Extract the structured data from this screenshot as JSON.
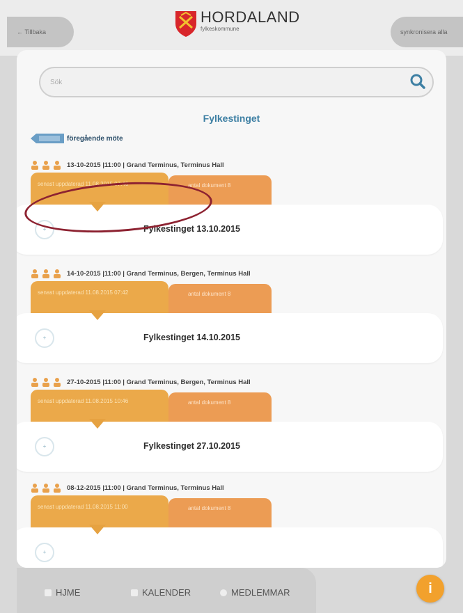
{
  "header": {
    "back_label": "← Tillbaka",
    "sync_label": "synkronisera alla",
    "logo_title": "HORDALAND",
    "logo_sub": "fylkeskommune"
  },
  "search": {
    "placeholder": "Sök"
  },
  "title": "Fylkestinget",
  "previous_label": "föregående möte",
  "meetings": [
    {
      "meta": "13-10-2015  |11:00  | Grand Terminus, Terminus Hall",
      "updated": "senast uppdaterad 11.08.2015 07:46",
      "docs": "antal dokument 8",
      "title": "Fylkestinget 13.10.2015"
    },
    {
      "meta": "14-10-2015  |11:00  | Grand Terminus, Bergen, Terminus Hall",
      "updated": "senast uppdaterad 11.08.2015 07:42",
      "docs": "antal dokument 8",
      "title": "Fylkestinget 14.10.2015"
    },
    {
      "meta": "27-10-2015  |11:00  | Grand Terminus, Bergen, Terminus Hall",
      "updated": "senast uppdaterad 11.08.2015 10:46",
      "docs": "antal dokument 8",
      "title": "Fylkestinget 27.10.2015"
    },
    {
      "meta": "08-12-2015  |11:00  | Grand Terminus, Terminus Hall",
      "updated": "senast uppdaterad 11.08.2015 11:00",
      "docs": "antal dokument 8",
      "title": ""
    }
  ],
  "nav": {
    "home": "HJME",
    "calendar": "KALENDER",
    "members": "MEDLEMMAR"
  },
  "colors": {
    "accent_orange": "#eba94a",
    "title_blue": "#3d7fa3",
    "highlight": "#8d2231"
  }
}
